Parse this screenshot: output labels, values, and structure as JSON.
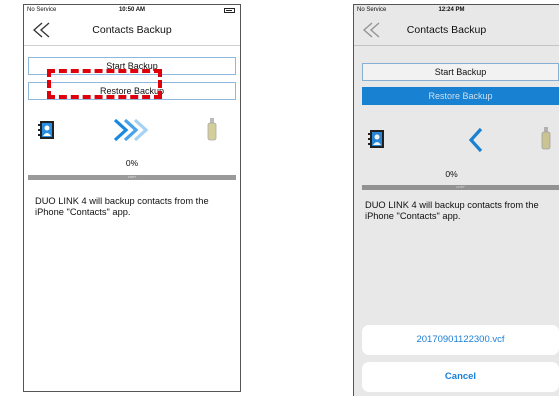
{
  "left_screen": {
    "status": {
      "carrier": "No Service",
      "time": "10:50 AM"
    },
    "nav": {
      "title": "Contacts Backup"
    },
    "buttons": {
      "start_backup": "Start Backup",
      "restore_backup": "Restore Backup"
    },
    "progress": {
      "percent_label": "0%",
      "bar_label": "COPY",
      "value": 0
    },
    "description": "DUO LINK 4 will backup contacts from the iPhone \"Contacts\" app."
  },
  "right_screen": {
    "status": {
      "carrier": "No Service",
      "time": "12:24 PM"
    },
    "nav": {
      "title": "Contacts Backup"
    },
    "buttons": {
      "start_backup": "Start Backup",
      "restore_backup": "Restore Backup"
    },
    "progress": {
      "percent_label": "0%",
      "bar_label": "COPY",
      "value": 0
    },
    "description": "DUO LINK 4 will backup contacts from the iPhone \"Contacts\" app.",
    "action_sheet": {
      "file_option": "20170901122300.vcf",
      "cancel": "Cancel"
    }
  },
  "colors": {
    "accent_blue": "#1a88de",
    "highlight_red": "#e0000b",
    "progress_gray": "#9a9a9a"
  },
  "icons": [
    "back-double-chevron-icon",
    "contacts-book-icon",
    "double-chevron-right-icon",
    "chevron-left-icon",
    "usb-drive-icon"
  ]
}
